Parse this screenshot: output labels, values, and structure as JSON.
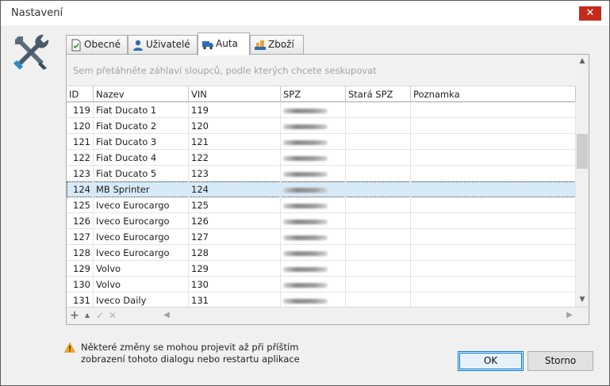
{
  "window": {
    "title": "Nastavení",
    "close_symbol": "✕"
  },
  "tabs": [
    {
      "label": "Obecné",
      "icon": "document-check-icon",
      "active": false
    },
    {
      "label": "Uživatelé",
      "icon": "user-icon",
      "active": false
    },
    {
      "label": "Auta",
      "icon": "truck-icon",
      "active": true
    },
    {
      "label": "Zboží",
      "icon": "goods-icon",
      "active": false
    }
  ],
  "grid": {
    "group_hint": "Sem přetáhněte záhlaví sloupců, podle kterých chcete seskupovat",
    "columns": [
      "ID",
      "Nazev",
      "VIN",
      "SPZ",
      "Stará SPZ",
      "Poznamka"
    ],
    "rows": [
      {
        "id": "119",
        "nazev": "Fiat Ducato 1",
        "vin": "119",
        "spz_blurred": true,
        "stara_spz": "",
        "poznamka": ""
      },
      {
        "id": "120",
        "nazev": "Fiat Ducato 2",
        "vin": "120",
        "spz_blurred": true,
        "stara_spz": "",
        "poznamka": ""
      },
      {
        "id": "121",
        "nazev": "Fiat Ducato 3",
        "vin": "121",
        "spz_blurred": true,
        "stara_spz": "",
        "poznamka": ""
      },
      {
        "id": "122",
        "nazev": "Fiat Ducato 4",
        "vin": "122",
        "spz_blurred": true,
        "stara_spz": "",
        "poznamka": ""
      },
      {
        "id": "123",
        "nazev": "Fiat Ducato 5",
        "vin": "123",
        "spz_blurred": true,
        "stara_spz": "",
        "poznamka": ""
      },
      {
        "id": "124",
        "nazev": "MB Sprinter",
        "vin": "124",
        "spz_blurred": true,
        "stara_spz": "",
        "poznamka": "",
        "selected": true
      },
      {
        "id": "125",
        "nazev": "Iveco Eurocargo",
        "vin": "125",
        "spz_blurred": true,
        "stara_spz": "",
        "poznamka": ""
      },
      {
        "id": "126",
        "nazev": "Iveco Eurocargo",
        "vin": "126",
        "spz_blurred": true,
        "stara_spz": "",
        "poznamka": ""
      },
      {
        "id": "127",
        "nazev": "Iveco Eurocargo",
        "vin": "127",
        "spz_blurred": true,
        "stara_spz": "",
        "poznamka": ""
      },
      {
        "id": "128",
        "nazev": "Iveco Eurocargo",
        "vin": "128",
        "spz_blurred": true,
        "stara_spz": "",
        "poznamka": ""
      },
      {
        "id": "129",
        "nazev": "Volvo",
        "vin": "129",
        "spz_blurred": true,
        "stara_spz": "",
        "poznamka": ""
      },
      {
        "id": "130",
        "nazev": "Volvo",
        "vin": "130",
        "spz_blurred": true,
        "stara_spz": "",
        "poznamka": ""
      },
      {
        "id": "131",
        "nazev": "Iveco Daily",
        "vin": "131",
        "spz_blurred": true,
        "stara_spz": "",
        "poznamka": ""
      }
    ],
    "navigator": {
      "add": "+",
      "up": "▲",
      "confirm": "✓",
      "cancel": "✕"
    },
    "scroll_arrows": {
      "up": "▲",
      "down": "▼",
      "left": "◀",
      "right": "▶"
    }
  },
  "footer": {
    "warning_line1": "Některé změny se mohou projevit až při příštím",
    "warning_line2": "zobrazení tohoto dialogu nebo restartu aplikace",
    "ok_label": "OK",
    "cancel_label": "Storno"
  },
  "colors": {
    "selected_row": "#d6eaf8",
    "close_button": "#c42b1c",
    "default_button_border": "#0078d7",
    "warning": "#f5a623"
  }
}
